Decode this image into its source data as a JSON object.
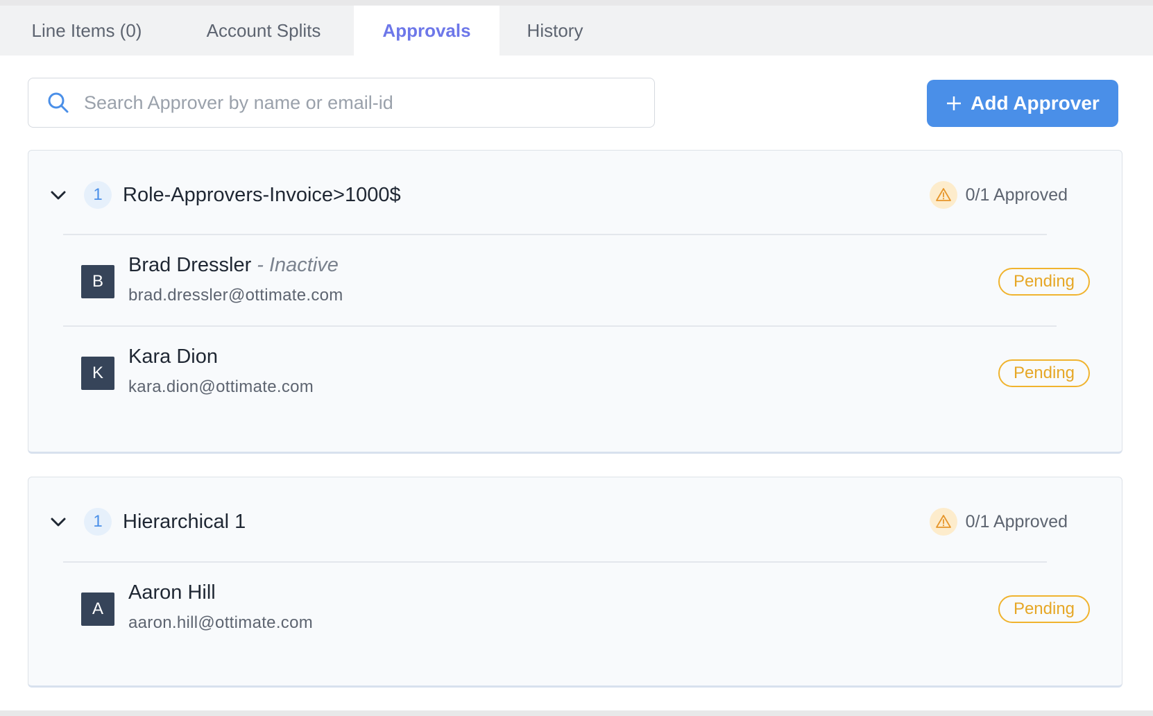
{
  "tabs": [
    {
      "label": "Line Items (0)",
      "active": false
    },
    {
      "label": "Account Splits",
      "active": false
    },
    {
      "label": "Approvals",
      "active": true
    },
    {
      "label": "History",
      "active": false
    }
  ],
  "search": {
    "placeholder": "Search Approver by name or email-id",
    "value": "",
    "icon": "search-icon"
  },
  "add_button": {
    "label": "Add Approver",
    "icon": "plus-icon"
  },
  "groups": [
    {
      "order": "1",
      "title": "Role-Approvers-Invoice>1000$",
      "status": "0/1 Approved",
      "status_icon": "warning-icon",
      "approvers": [
        {
          "initial": "B",
          "name": "Brad Dressler",
          "inactive": "- Inactive",
          "email": "brad.dressler@ottimate.com",
          "status": "Pending"
        },
        {
          "initial": "K",
          "name": "Kara Dion",
          "inactive": "",
          "email": "kara.dion@ottimate.com",
          "status": "Pending"
        }
      ]
    },
    {
      "order": "1",
      "title": "Hierarchical 1",
      "status": "0/1 Approved",
      "status_icon": "warning-icon",
      "approvers": [
        {
          "initial": "A",
          "name": "Aaron Hill",
          "inactive": "",
          "email": "aaron.hill@ottimate.com",
          "status": "Pending"
        }
      ]
    }
  ],
  "colors": {
    "accent": "#4a8fe8",
    "active_tab": "#6d77e9",
    "pending": "#f0b32e",
    "avatar_bg": "#364459",
    "warning_bg": "#fdeccc"
  }
}
